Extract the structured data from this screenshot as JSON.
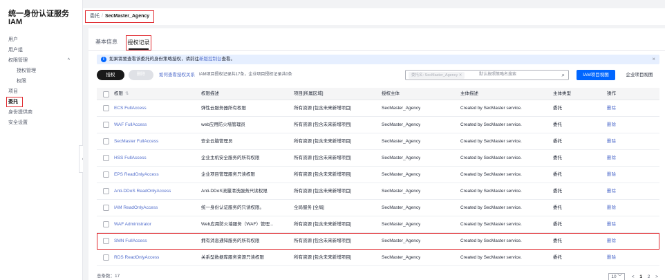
{
  "sidebar": {
    "title": "统一身份认证服务",
    "subtitle": "IAM",
    "items": [
      {
        "label": "用户",
        "child": false,
        "active": false
      },
      {
        "label": "用户组",
        "child": false,
        "active": false
      },
      {
        "label": "权限管理",
        "child": false,
        "active": false,
        "chevron": "^"
      },
      {
        "label": "授权管理",
        "child": true,
        "active": false
      },
      {
        "label": "权限",
        "child": true,
        "active": false
      },
      {
        "label": "项目",
        "child": false,
        "active": false
      },
      {
        "label": "委托",
        "child": false,
        "active": true
      },
      {
        "label": "身份提供商",
        "child": false,
        "active": false
      },
      {
        "label": "安全设置",
        "child": false,
        "active": false
      }
    ],
    "collapse_glyph": "‹"
  },
  "breadcrumb": {
    "parent": "委托",
    "separator": "/",
    "current": "SecMaster_Agency"
  },
  "tabs": [
    {
      "label": "基本信息"
    },
    {
      "label": "授权记录"
    }
  ],
  "notice": {
    "text_before": "如果需要查看该委托的身份策略授权，请前往",
    "link": "新版控制台",
    "text_after": "查看。",
    "close_glyph": "×"
  },
  "toolbar": {
    "grant_label": "授权",
    "delete_label": "删除",
    "help_link": "如何查看授权关系",
    "info": "IAM项目授权记录共17条，企业项目授权记录共0条",
    "search_chip": "委托名: SecMaster_Agency ✕",
    "search_placeholder": "默认按照策略名搜索",
    "iam_view": "IAM项目视图",
    "ep_view": "企业项目视图"
  },
  "table": {
    "columns": [
      "权限",
      "权限描述",
      "项目[所属区域]",
      "授权主体",
      "主体描述",
      "主体类型",
      "操作"
    ],
    "rows": [
      {
        "policy": "ECS FullAccess",
        "desc": "弹性云服务器所有权限",
        "project": "所有资源 [包含未来新增项目]",
        "principal": "SecMaster_Agency",
        "pdesc": "Created by SecMaster service.",
        "ptype": "委托",
        "op": "删除"
      },
      {
        "policy": "WAF FullAccess",
        "desc": "web应用防火墙管理员",
        "project": "所有资源 [包含未来新增项目]",
        "principal": "SecMaster_Agency",
        "pdesc": "Created by SecMaster service.",
        "ptype": "委托",
        "op": "删除"
      },
      {
        "policy": "SecMaster FullAccess",
        "desc": "安全云脑管理员",
        "project": "所有资源 [包含未来新增项目]",
        "principal": "SecMaster_Agency",
        "pdesc": "Created by SecMaster service.",
        "ptype": "委托",
        "op": "删除"
      },
      {
        "policy": "HSS FullAccess",
        "desc": "企业主机安全服务的所有权限",
        "project": "所有资源 [包含未来新增项目]",
        "principal": "SecMaster_Agency",
        "pdesc": "Created by SecMaster service.",
        "ptype": "委托",
        "op": "删除"
      },
      {
        "policy": "EPS ReadOnlyAccess",
        "desc": "企业项目管理服务只读权限",
        "project": "所有资源 [包含未来新增项目]",
        "principal": "SecMaster_Agency",
        "pdesc": "Created by SecMaster service.",
        "ptype": "委托",
        "op": "删除"
      },
      {
        "policy": "Anti-DDoS ReadOnlyAccess",
        "desc": "Anti-DDoS流量清洗服务只读权限",
        "project": "所有资源 [包含未来新增项目]",
        "principal": "SecMaster_Agency",
        "pdesc": "Created by SecMaster service.",
        "ptype": "委托",
        "op": "删除"
      },
      {
        "policy": "IAM ReadOnlyAccess",
        "desc": "统一身份认证服务的只读权限。",
        "project": "全局服务 [全局]",
        "principal": "SecMaster_Agency",
        "pdesc": "Created by SecMaster service.",
        "ptype": "委托",
        "op": "删除"
      },
      {
        "policy": "WAF Administrator",
        "desc": "Web应用防火墙服务（WAF）管理...",
        "project": "所有资源 [包含未来新增项目]",
        "principal": "SecMaster_Agency",
        "pdesc": "Created by SecMaster service.",
        "ptype": "委托",
        "op": "删除"
      },
      {
        "policy": "SMN FullAccess",
        "desc": "拥有消息通知服务的所有权限",
        "project": "所有资源 [包含未来新增项目]",
        "principal": "SecMaster_Agency",
        "pdesc": "Created by SecMaster service.",
        "ptype": "委托",
        "op": "删除",
        "highlight": true
      },
      {
        "policy": "RDS ReadOnlyAccess",
        "desc": "关系型数据库服务资源只读权限",
        "project": "所有资源 [包含未来新增项目]",
        "principal": "SecMaster_Agency",
        "pdesc": "Created by SecMaster service.",
        "ptype": "委托",
        "op": "删除"
      }
    ]
  },
  "footer": {
    "total": "总条数：17",
    "page_size": "10 ﹀",
    "prev": "<",
    "page1": "1",
    "page2": "2",
    "next": ">"
  }
}
